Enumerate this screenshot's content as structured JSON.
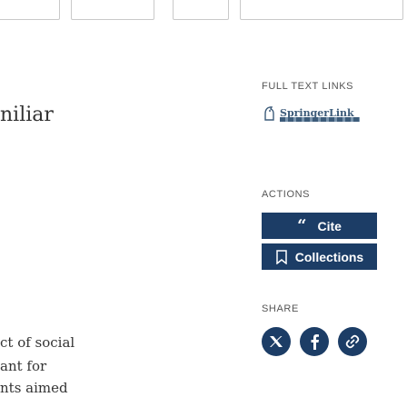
{
  "left_article": {
    "title_fragment": "niliar",
    "text_lines": [
      "ct of social",
      "ant for",
      "nts aimed"
    ]
  },
  "sidebar": {
    "full_text_links_label": "FULL TEXT LINKS",
    "springer_link_label": "SpringerLink",
    "actions_label": "ACTIONS",
    "cite_button": "Cite",
    "collections_button": "Collections",
    "share_label": "SHARE"
  },
  "share_buttons": [
    "twitter-icon",
    "facebook-icon",
    "permalink-icon"
  ],
  "colors": {
    "primary": "#1c3d66",
    "springer": "#3d5c7a"
  }
}
